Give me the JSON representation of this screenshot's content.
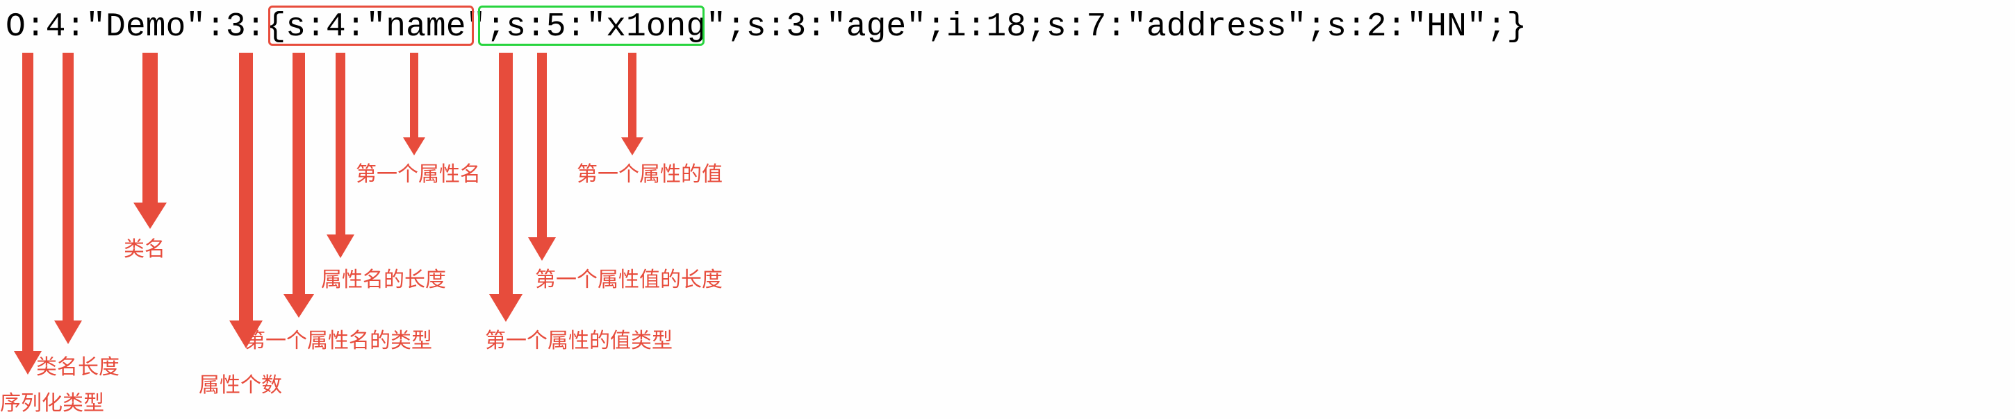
{
  "code": "O:4:\"Demo\":3:{s:4:\"name\";s:5:\"x1ong\";s:3:\"age\";i:18;s:7:\"address\";s:2:\"HN\";}",
  "labels": {
    "serial_type": "序列化类型",
    "classname_len": "类名长度",
    "classname": "类名",
    "attr_count": "属性个数",
    "first_attr_name_type": "第一个属性名的类型",
    "attr_name_len": "属性名的长度",
    "first_attr_name": "第一个属性名",
    "first_attr_value_type": "第一个属性的值类型",
    "first_attr_value_len": "第一个属性值的长度",
    "first_attr_value": "第一个属性的值"
  }
}
